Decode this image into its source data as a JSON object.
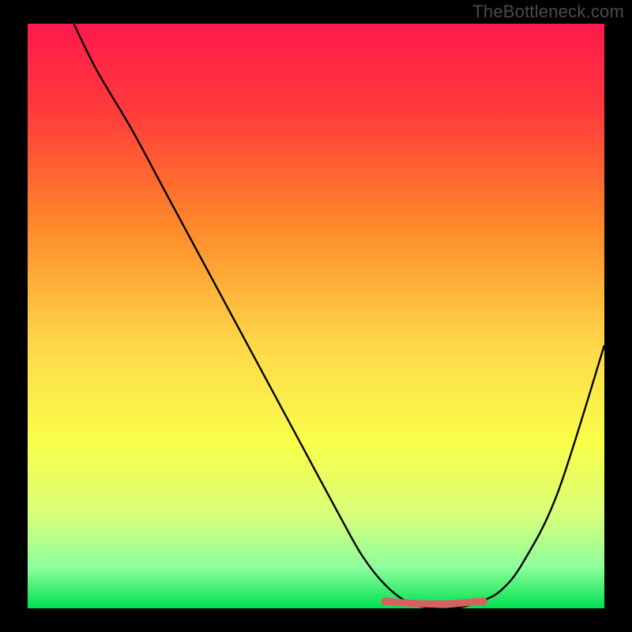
{
  "watermark": "TheBottleneck.com",
  "colors": {
    "frame_bg": "#000000",
    "watermark_text": "#4a4a4a",
    "gradient_stops": [
      {
        "offset": 0.0,
        "color": "#ff1a4d"
      },
      {
        "offset": 0.15,
        "color": "#ff3b3b"
      },
      {
        "offset": 0.35,
        "color": "#ff8a2a"
      },
      {
        "offset": 0.55,
        "color": "#ffd84a"
      },
      {
        "offset": 0.72,
        "color": "#f8ff4a"
      },
      {
        "offset": 0.84,
        "color": "#d8ff7a"
      },
      {
        "offset": 0.93,
        "color": "#8cff9c"
      },
      {
        "offset": 1.0,
        "color": "#00e04f"
      }
    ],
    "curve_stroke": "#000000",
    "local_min_marker": "#d96060"
  },
  "chart_data": {
    "type": "line",
    "title": "",
    "xlabel": "",
    "ylabel": "",
    "xlim": [
      0,
      100
    ],
    "ylim": [
      0,
      100
    ],
    "grid": false,
    "series": [
      {
        "name": "bottleneck-curve",
        "x": [
          8,
          12,
          18,
          24,
          30,
          36,
          42,
          48,
          54,
          58,
          62,
          66,
          70,
          74,
          78,
          82,
          86,
          92,
          100
        ],
        "y": [
          100,
          92,
          82,
          71,
          60,
          49,
          38,
          27,
          16,
          9,
          4,
          1,
          0,
          0,
          1,
          3,
          8,
          20,
          45
        ]
      }
    ],
    "annotations": [
      {
        "name": "local-minimum-highlight",
        "x_range": [
          62,
          79
        ],
        "y": 1,
        "color": "#d96060"
      }
    ]
  }
}
